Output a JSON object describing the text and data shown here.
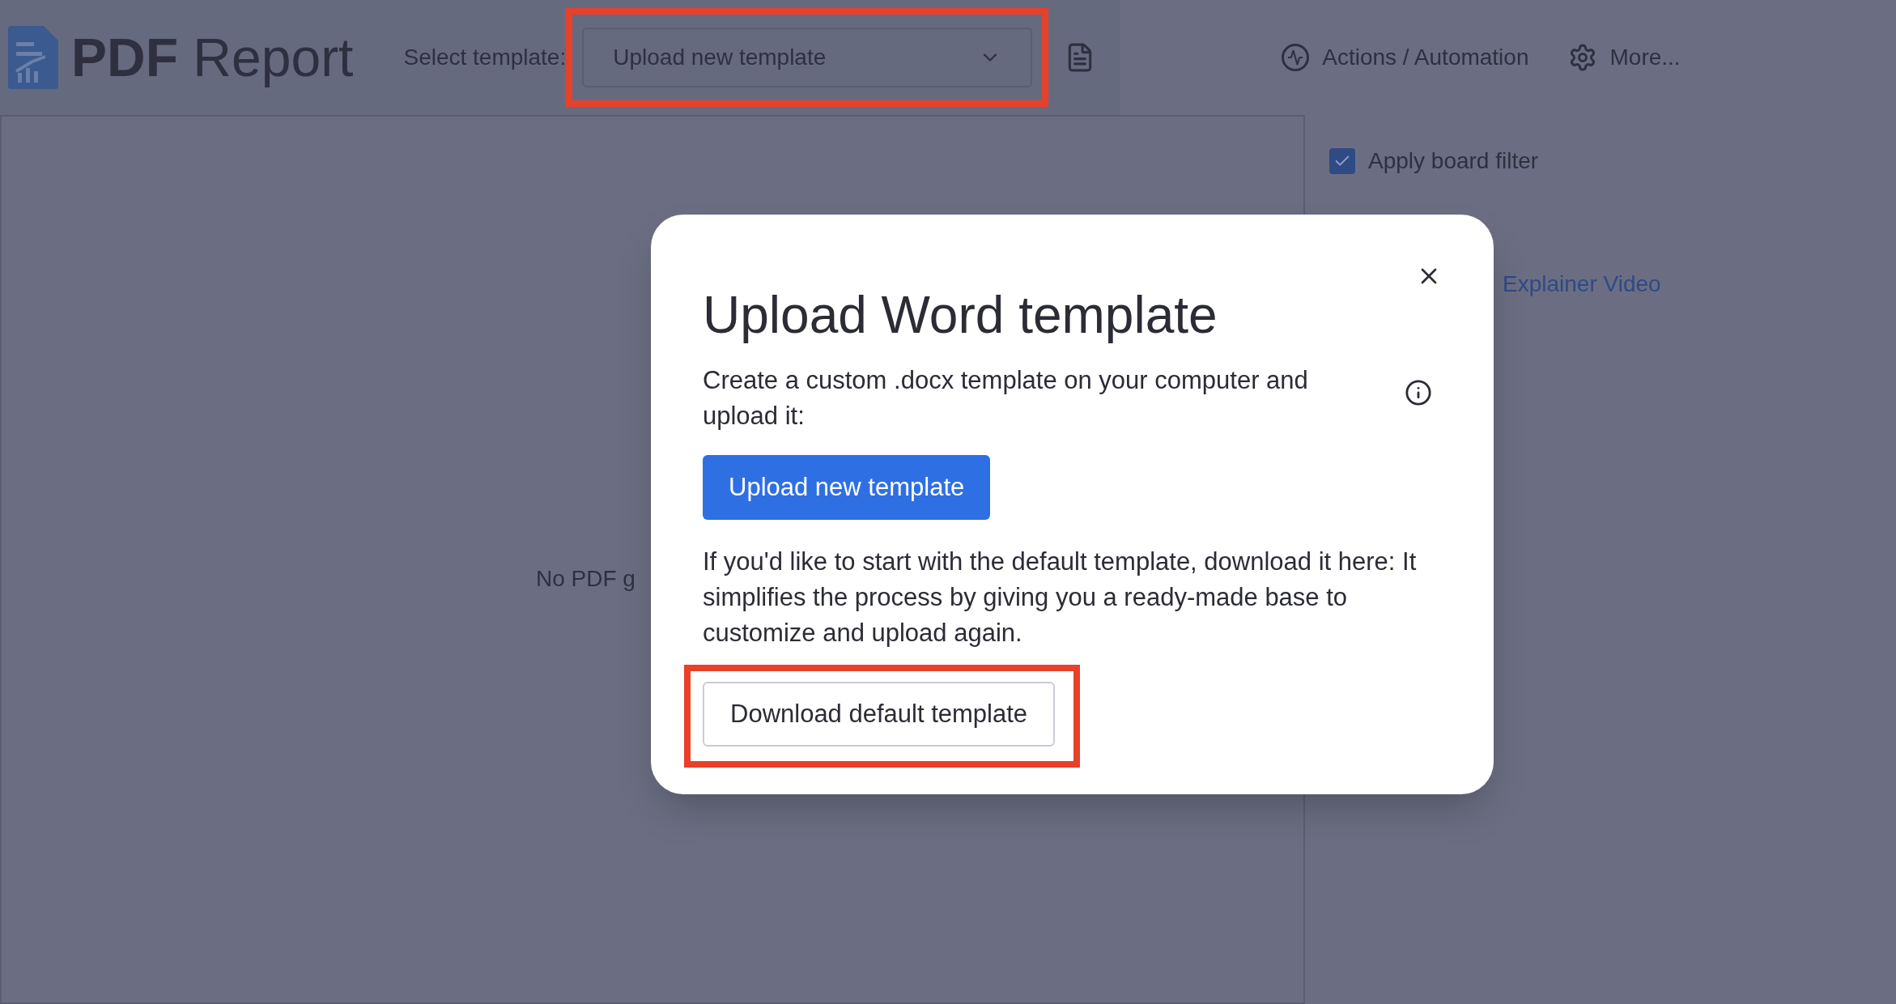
{
  "header": {
    "app_title_bold": "PDF",
    "app_title_light": "Report",
    "template_label": "Select template:",
    "template_select": {
      "value": "Upload new template",
      "highlighted": true
    },
    "nav": [
      {
        "kind": "activity",
        "label": "Actions / Automation"
      },
      {
        "kind": "settings",
        "label": "More..."
      }
    ]
  },
  "preview": {
    "empty_text": "No PDF g"
  },
  "sidebar": {
    "apply_filter": {
      "label": "Apply board filter",
      "checked": true
    },
    "video_link": "Explainer Video"
  },
  "dialog": {
    "title": "Upload Word template",
    "intro": "Create a custom .docx template on your computer and upload it:",
    "upload_button": "Upload new template",
    "default_text": "If you'd like to start with the default template, download it here: It simplifies the process by giving you a ready-made base to customize and upload again.",
    "download_button": {
      "label": "Download default template",
      "highlighted": true
    }
  }
}
